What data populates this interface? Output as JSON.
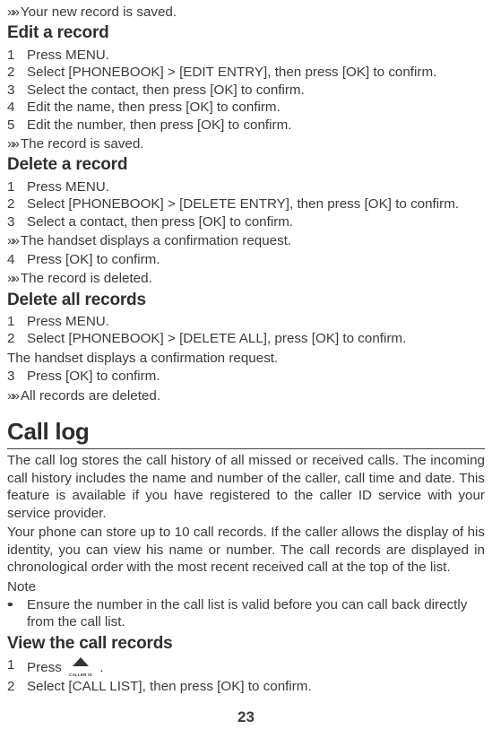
{
  "top_result": "Your new record is saved.",
  "edit": {
    "title": "Edit a record",
    "s1": "Press MENU.",
    "s2": "Select [PHONEBOOK] > [EDIT ENTRY], then press [OK] to confirm.",
    "s3": "Select the contact, then press [OK] to confirm.",
    "s4": "Edit the name, then press [OK] to confirm.",
    "s5": "Edit the number, then press [OK] to confirm.",
    "r": "The record is saved."
  },
  "del": {
    "title": "Delete a record",
    "s1": "Press MENU.",
    "s2": "Select [PHONEBOOK] > [DELETE ENTRY], then press [OK] to confirm.",
    "s3": "Select a contact, then press [OK] to confirm.",
    "r1": "The handset displays a confirmation request.",
    "s4": "Press [OK] to confirm.",
    "r2": "The record is deleted."
  },
  "delall": {
    "title": "Delete all records",
    "s1": "Press MENU.",
    "s2": "Select [PHONEBOOK] > [DELETE ALL], press [OK] to confirm.",
    "plain": "The handset displays a confirmation request.",
    "s3": "Press [OK] to confirm.",
    "r": "All records are deleted."
  },
  "calllog": {
    "title": "Call log",
    "p1": "The call log stores the call history of all missed or received calls. The incoming call history includes the name and number of the caller, call time and date. This feature is available if you have registered to the caller ID service with your service provider.",
    "p2": "Your phone can store up to 10 call records. If the caller allows the display of his identity, you can view his name or number. The call records are displayed in chronological order with the most recent received call at the top of the list.",
    "note_label": "Note",
    "note1": "Ensure the number in the call list is valid before you can call back directly from the call list."
  },
  "view": {
    "title": "View the call records",
    "s1a": "Press ",
    "s1b": " .",
    "s2": "Select [CALL LIST], then press [OK] to confirm.",
    "icon_label": "CALLER ID"
  },
  "nums": {
    "n1": "1",
    "n2": "2",
    "n3": "3",
    "n4": "4",
    "n5": "5"
  },
  "pagenum": "23"
}
